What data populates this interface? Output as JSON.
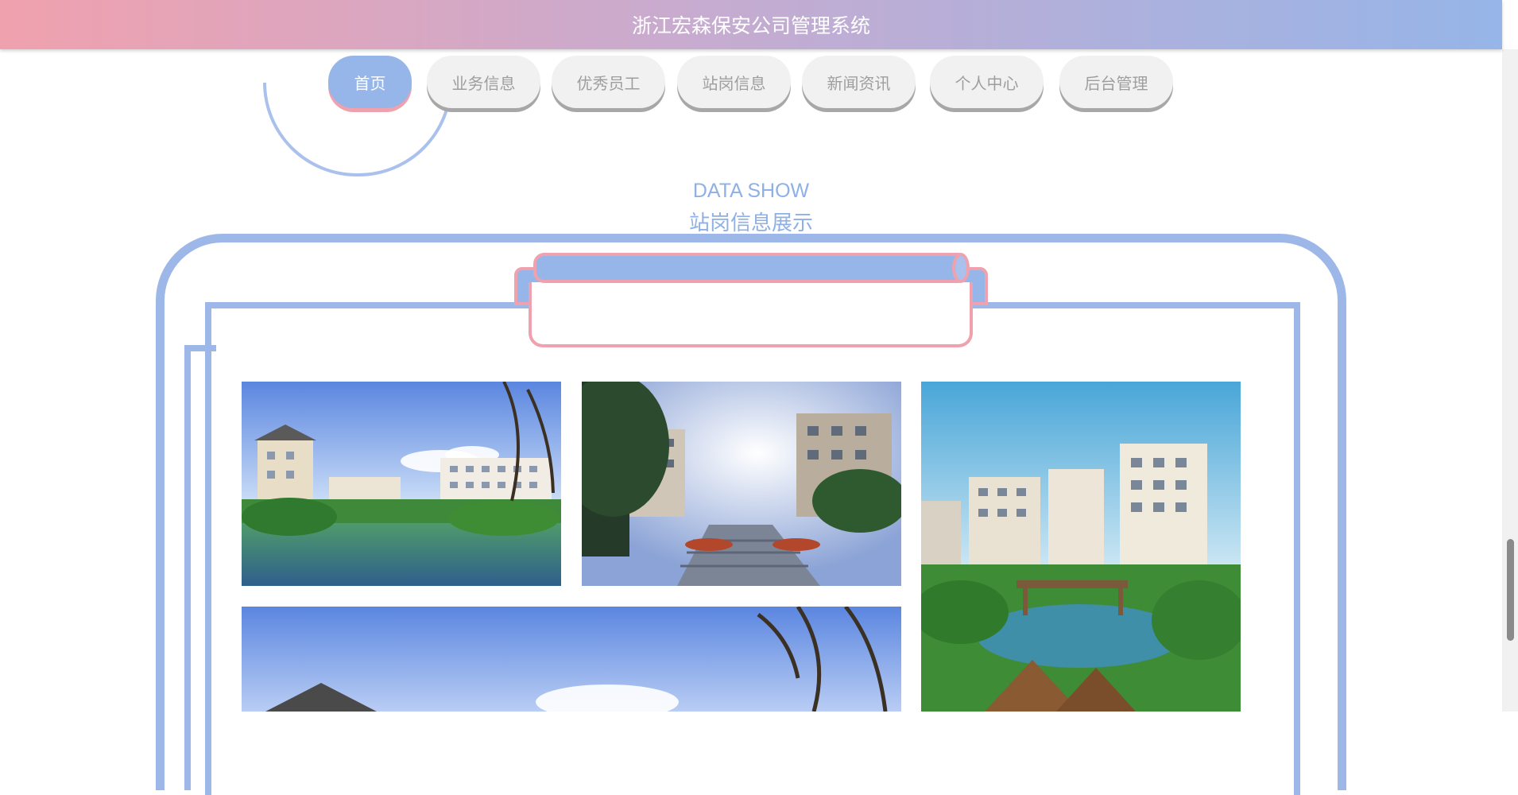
{
  "header": {
    "title": "浙江宏森保安公司管理系统"
  },
  "nav": {
    "items": [
      {
        "label": "首页",
        "active": true
      },
      {
        "label": "业务信息",
        "active": false
      },
      {
        "label": "优秀员工",
        "active": false
      },
      {
        "label": "站岗信息",
        "active": false
      },
      {
        "label": "新闻资讯",
        "active": false
      },
      {
        "label": "个人中心",
        "active": false
      },
      {
        "label": "后台管理",
        "active": false
      }
    ]
  },
  "section": {
    "title_en": "DATA SHOW",
    "title_cn": "站岗信息展示"
  },
  "gallery": {
    "images": [
      {
        "subject": "residential complex by a lake under blue sky"
      },
      {
        "subject": "apartment courtyard walkway with stairs"
      },
      {
        "subject": "tall residential towers with a garden and pond"
      },
      {
        "subject": "lakeside apartment buildings with trees"
      }
    ]
  },
  "colors": {
    "accent_blue": "#96b5e8",
    "accent_pink": "#f0a1ae",
    "nav_inactive": "#f1f1f1"
  }
}
